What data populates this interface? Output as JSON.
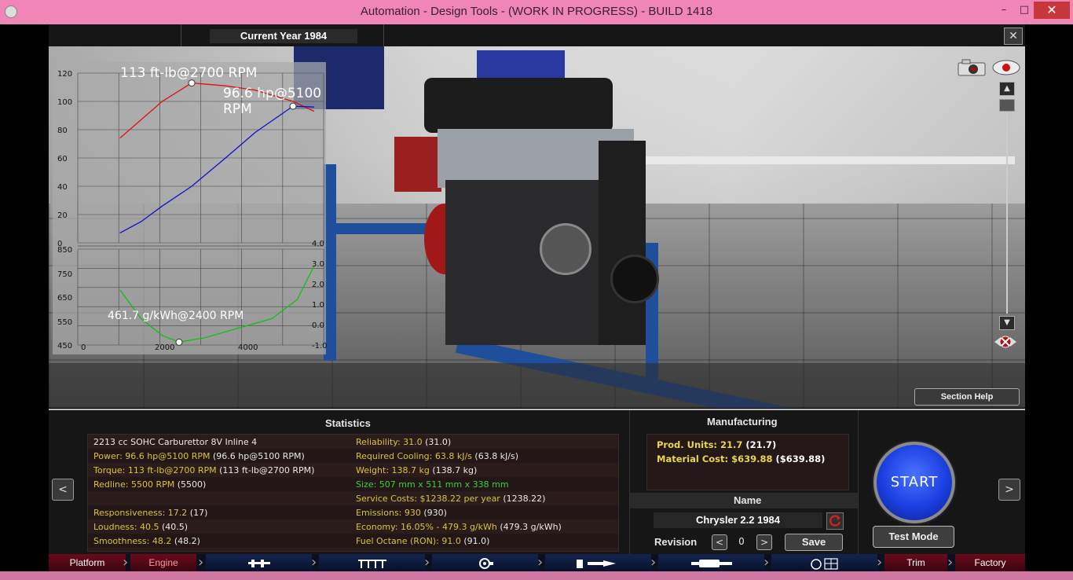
{
  "window": {
    "title": "Automation - Design Tools - (WORK IN PROGRESS) - BUILD 1418",
    "minimize": "–",
    "maximize": "□",
    "close": "✕"
  },
  "topbar": {
    "year": "Current Year 1984",
    "close": "✕"
  },
  "graph": {
    "torque_label": "113 ft-lb@2700 RPM",
    "power_label": "96.6 hp@5100 RPM",
    "bsfc_label": "461.7 g/kWh@2400 RPM",
    "top_y_ticks": [
      "120",
      "100",
      "80",
      "60",
      "40",
      "20",
      "0"
    ],
    "bottom_y_ticks": [
      "850",
      "750",
      "650",
      "550",
      "450"
    ],
    "right_y_ticks": [
      "4.0",
      "3.0",
      "2.0",
      "1.0",
      "0.0",
      "-1.0"
    ],
    "x_ticks": [
      "0",
      "2000",
      "4000"
    ]
  },
  "viewport": {
    "section_help": "Section Help"
  },
  "statistics": {
    "header": "Statistics",
    "left": [
      {
        "label": "2213 cc SOHC Carburettor 8V Inline 4",
        "paren": "",
        "color": "white"
      },
      {
        "label": "Power: 96.6 hp@5100 RPM",
        "paren": " (96.6 hp@5100 RPM)",
        "color": "yellow"
      },
      {
        "label": "Torque: 113 ft-lb@2700 RPM",
        "paren": " (113 ft-lb@2700 RPM)",
        "color": "yellow"
      },
      {
        "label": "Redline: 5500 RPM",
        "paren": " (5500)",
        "color": "yellow"
      },
      {
        "label": "Responsiveness: 17.2",
        "paren": " (17)",
        "color": "yellow"
      },
      {
        "label": "Loudness: 40.5",
        "paren": " (40.5)",
        "color": "yellow"
      },
      {
        "label": "Smoothness: 48.2",
        "paren": " (48.2)",
        "color": "yellow"
      }
    ],
    "right": [
      {
        "label": "Reliability: 31.0",
        "paren": " (31.0)",
        "color": "yellow"
      },
      {
        "label": "Required Cooling: 63.8 kJ/s",
        "paren": " (63.8 kJ/s)",
        "color": "yellow"
      },
      {
        "label": "Weight: 138.7 kg",
        "paren": " (138.7 kg)",
        "color": "yellow"
      },
      {
        "label": "Size: 507 mm x 511 mm x 338 mm",
        "paren": "",
        "color": "green"
      },
      {
        "label": "Service Costs: $1238.22 per year",
        "paren": " (1238.22)",
        "color": "yellow"
      },
      {
        "label": "Emissions: 930",
        "paren": " (930)",
        "color": "yellow"
      },
      {
        "label": "Economy: 16.05% - 479.3 g/kWh",
        "paren": " (479.3 g/kWh)",
        "color": "yellow"
      },
      {
        "label": "Fuel Octane (RON): 91.0",
        "paren": " (91.0)",
        "color": "yellow"
      }
    ]
  },
  "manufacturing": {
    "header": "Manufacturing",
    "prod_units": "Prod. Units: 21.7",
    "prod_units_paren": " (21.7)",
    "material_cost": "Material Cost: $639.88",
    "material_cost_paren": " ($639.88)"
  },
  "name_section": {
    "header": "Name",
    "name": "Chrysler 2.2 1984",
    "revision_label": "Revision",
    "revision": "0",
    "save": "Save",
    "prev": "<",
    "next": ">"
  },
  "controls": {
    "start": "START",
    "test_mode": "Test Mode",
    "left_arrow": "<",
    "right_arrow": ">"
  },
  "nav": {
    "platform": "Platform",
    "engine": "Engine",
    "trim": "Trim",
    "factory": "Factory"
  },
  "colors": {
    "torque": "#e01010",
    "power": "#1010d0",
    "bsfc": "#10c010",
    "start_blue": "#1b3fe0",
    "title_pink": "#f085b8"
  }
}
